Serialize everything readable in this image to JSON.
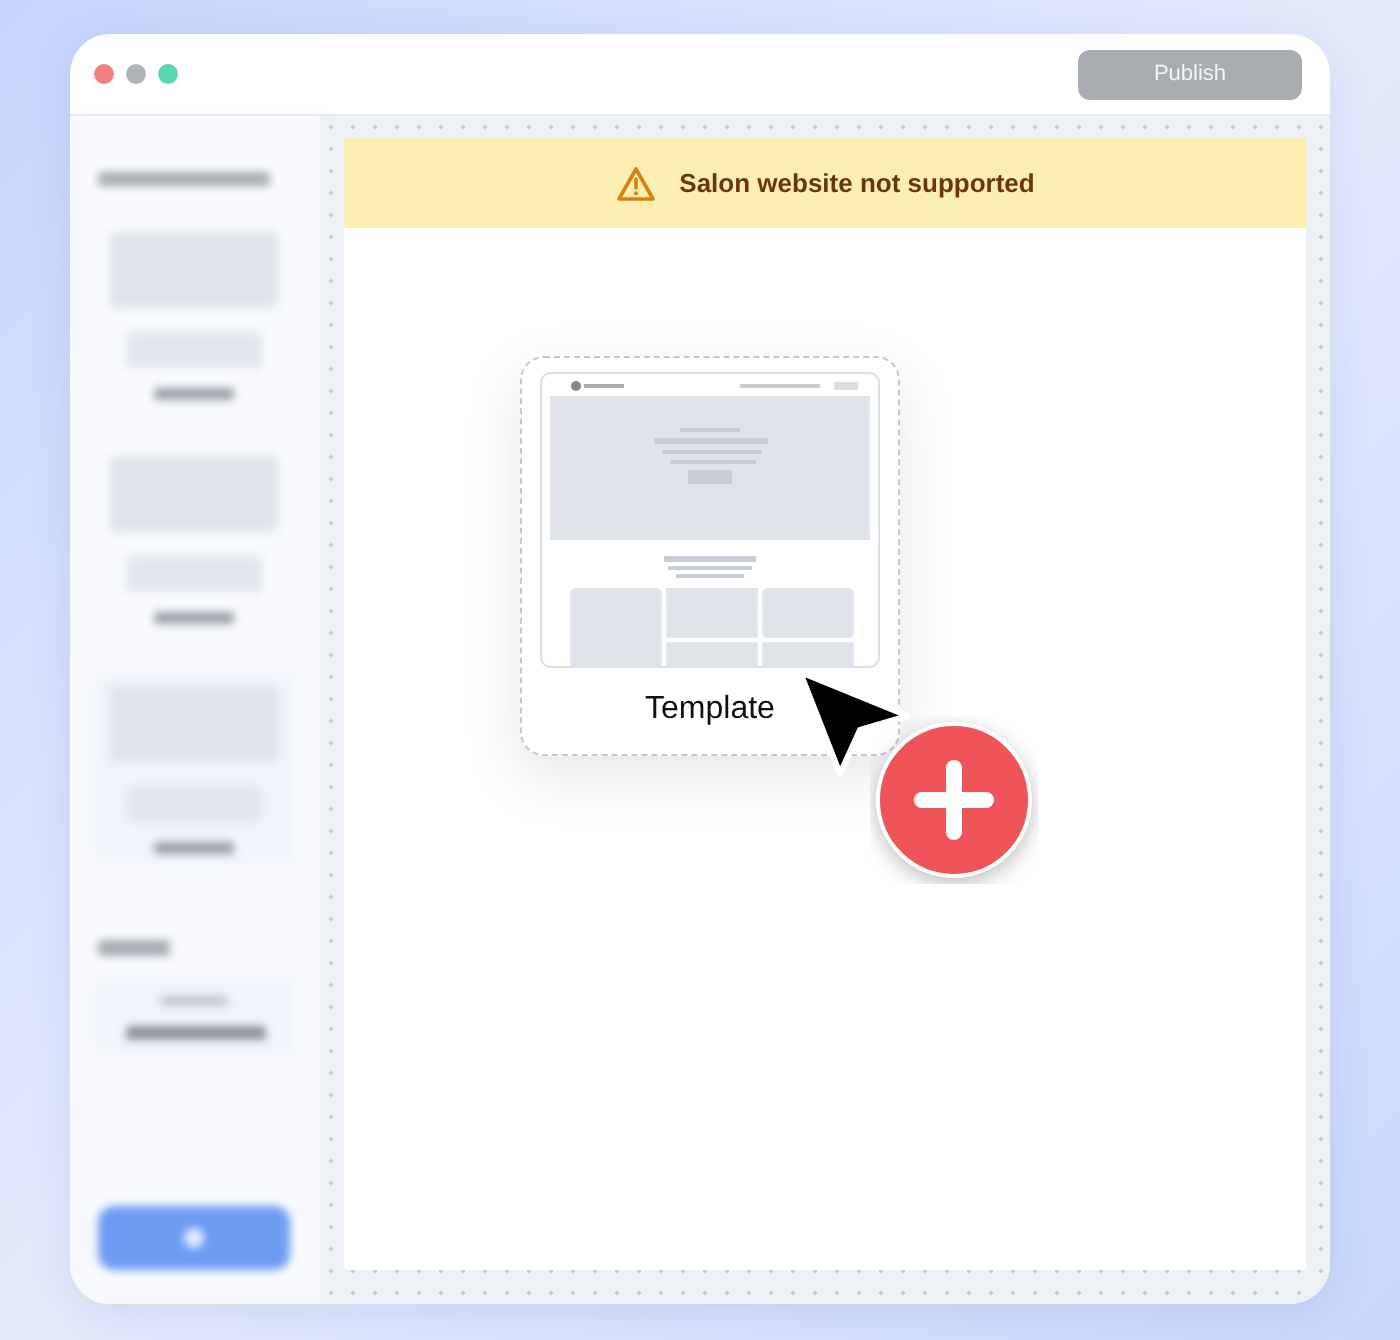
{
  "toolbar": {
    "publish_button": {
      "label": "Publish",
      "disabled": true
    }
  },
  "banner": {
    "message": "Salon website not supported"
  },
  "drag_card": {
    "label": "Template"
  }
}
